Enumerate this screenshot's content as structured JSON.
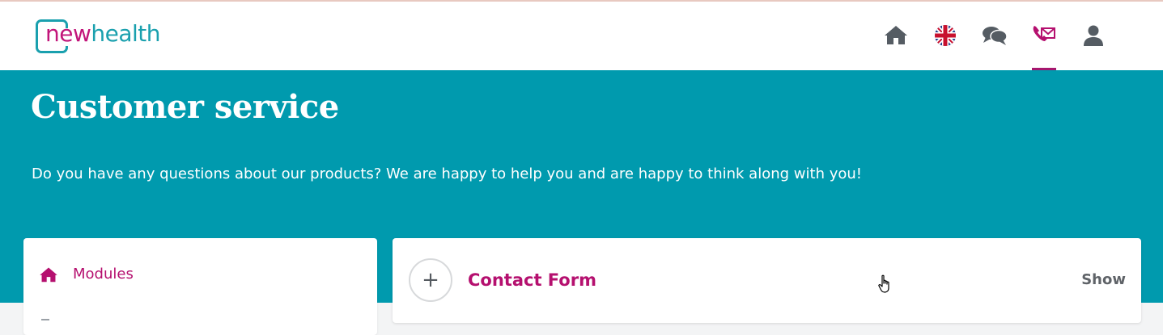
{
  "header": {
    "logo": {
      "part1": "new",
      "part2": "health"
    },
    "nav": [
      {
        "icon": "home-icon"
      },
      {
        "icon": "uk-flag-icon"
      },
      {
        "icon": "chat-icon"
      },
      {
        "icon": "contact-mail-icon",
        "active": true
      },
      {
        "icon": "user-icon"
      }
    ]
  },
  "hero": {
    "title": "Customer service",
    "text": "Do you have any questions about our products? We are happy to help you and are happy to think along with you!"
  },
  "sidebar": {
    "items": [
      {
        "label": "Modules",
        "icon": "home-icon"
      }
    ]
  },
  "card": {
    "expand_symbol": "+",
    "title": "Contact Form",
    "action_label": "Show"
  },
  "colors": {
    "brand_teal": "#009aae",
    "brand_magenta": "#b5106f",
    "icon_gray": "#555c63"
  }
}
